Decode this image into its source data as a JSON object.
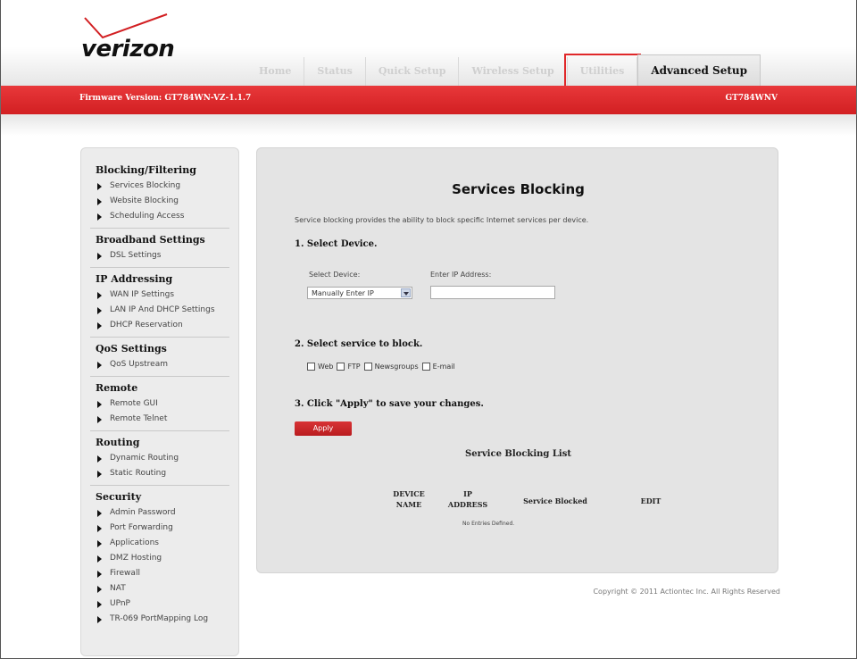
{
  "brand": {
    "name": "verizon",
    "accent": "#d21f22"
  },
  "tabs": [
    {
      "label": "Home"
    },
    {
      "label": "Status"
    },
    {
      "label": "Quick Setup"
    },
    {
      "label": "Wireless Setup"
    },
    {
      "label": "Utilities"
    },
    {
      "label": "Advanced Setup"
    }
  ],
  "header": {
    "firmware": "Firmware Version: GT784WN-VZ-1.1.7",
    "model": "GT784WNV"
  },
  "sidebar": {
    "sections": [
      {
        "title": "Blocking/Filtering",
        "items": [
          "Services Blocking",
          "Website Blocking",
          "Scheduling Access"
        ]
      },
      {
        "title": "Broadband Settings",
        "items": [
          "DSL Settings"
        ]
      },
      {
        "title": "IP Addressing",
        "items": [
          "WAN IP Settings",
          "LAN IP And DHCP Settings",
          "DHCP Reservation"
        ]
      },
      {
        "title": "QoS Settings",
        "items": [
          "QoS Upstream"
        ]
      },
      {
        "title": "Remote",
        "items": [
          "Remote GUI",
          "Remote Telnet"
        ]
      },
      {
        "title": "Routing",
        "items": [
          "Dynamic Routing",
          "Static Routing"
        ]
      },
      {
        "title": "Security",
        "items": [
          "Admin Password",
          "Port Forwarding",
          "Applications",
          "DMZ Hosting",
          "Firewall",
          "NAT",
          "UPnP",
          "TR-069 PortMapping Log"
        ]
      }
    ]
  },
  "main": {
    "title": "Services Blocking",
    "description": "Service blocking provides the ability to block specific Internet services per device.",
    "step1": "1. Select Device.",
    "select_device_label": "Select Device:",
    "select_device_value": "Manually Enter IP",
    "ip_label": "Enter IP Address:",
    "ip_value": "",
    "step2": "2. Select service to block.",
    "services": [
      "Web",
      "FTP",
      "Newsgroups",
      "E-mail"
    ],
    "step3": "3. Click \"Apply\" to save your changes.",
    "apply_label": "Apply",
    "list_title": "Service Blocking List",
    "columns": [
      "DEVICE NAME",
      "IP ADDRESS",
      "Service Blocked",
      "EDIT"
    ],
    "empty_text": "No Entries Defined."
  },
  "footer": {
    "copyright": "Copyright © 2011 Actiontec Inc. All Rights Reserved"
  }
}
